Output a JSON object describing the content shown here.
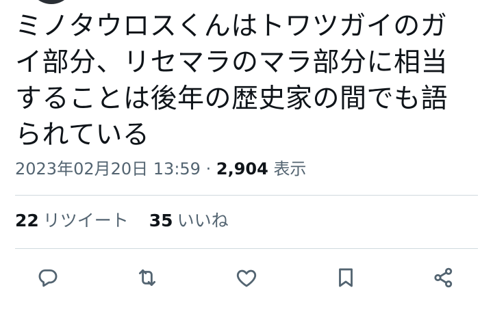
{
  "tweet": {
    "lines": [
      "ミノタウロスくんはトワツガイのガ",
      "イ部分、リセマラのマラ部分に相当",
      "することは後年の歴史家の間でも語",
      "られている"
    ],
    "timestamp": "2023年02月20日 13:59",
    "separator": "·",
    "views_count": "2,904",
    "views_label": "表示"
  },
  "stats": {
    "retweets_count": "22",
    "retweets_label": "リツイート",
    "likes_count": "35",
    "likes_label": "いいね"
  },
  "actions": [
    {
      "icon": "reply-icon"
    },
    {
      "icon": "retweet-icon"
    },
    {
      "icon": "like-icon"
    },
    {
      "icon": "bookmark-icon"
    },
    {
      "icon": "share-icon"
    }
  ],
  "colors": {
    "text": "#0f1419",
    "secondary": "#536471",
    "divider": "#cfd9de"
  }
}
